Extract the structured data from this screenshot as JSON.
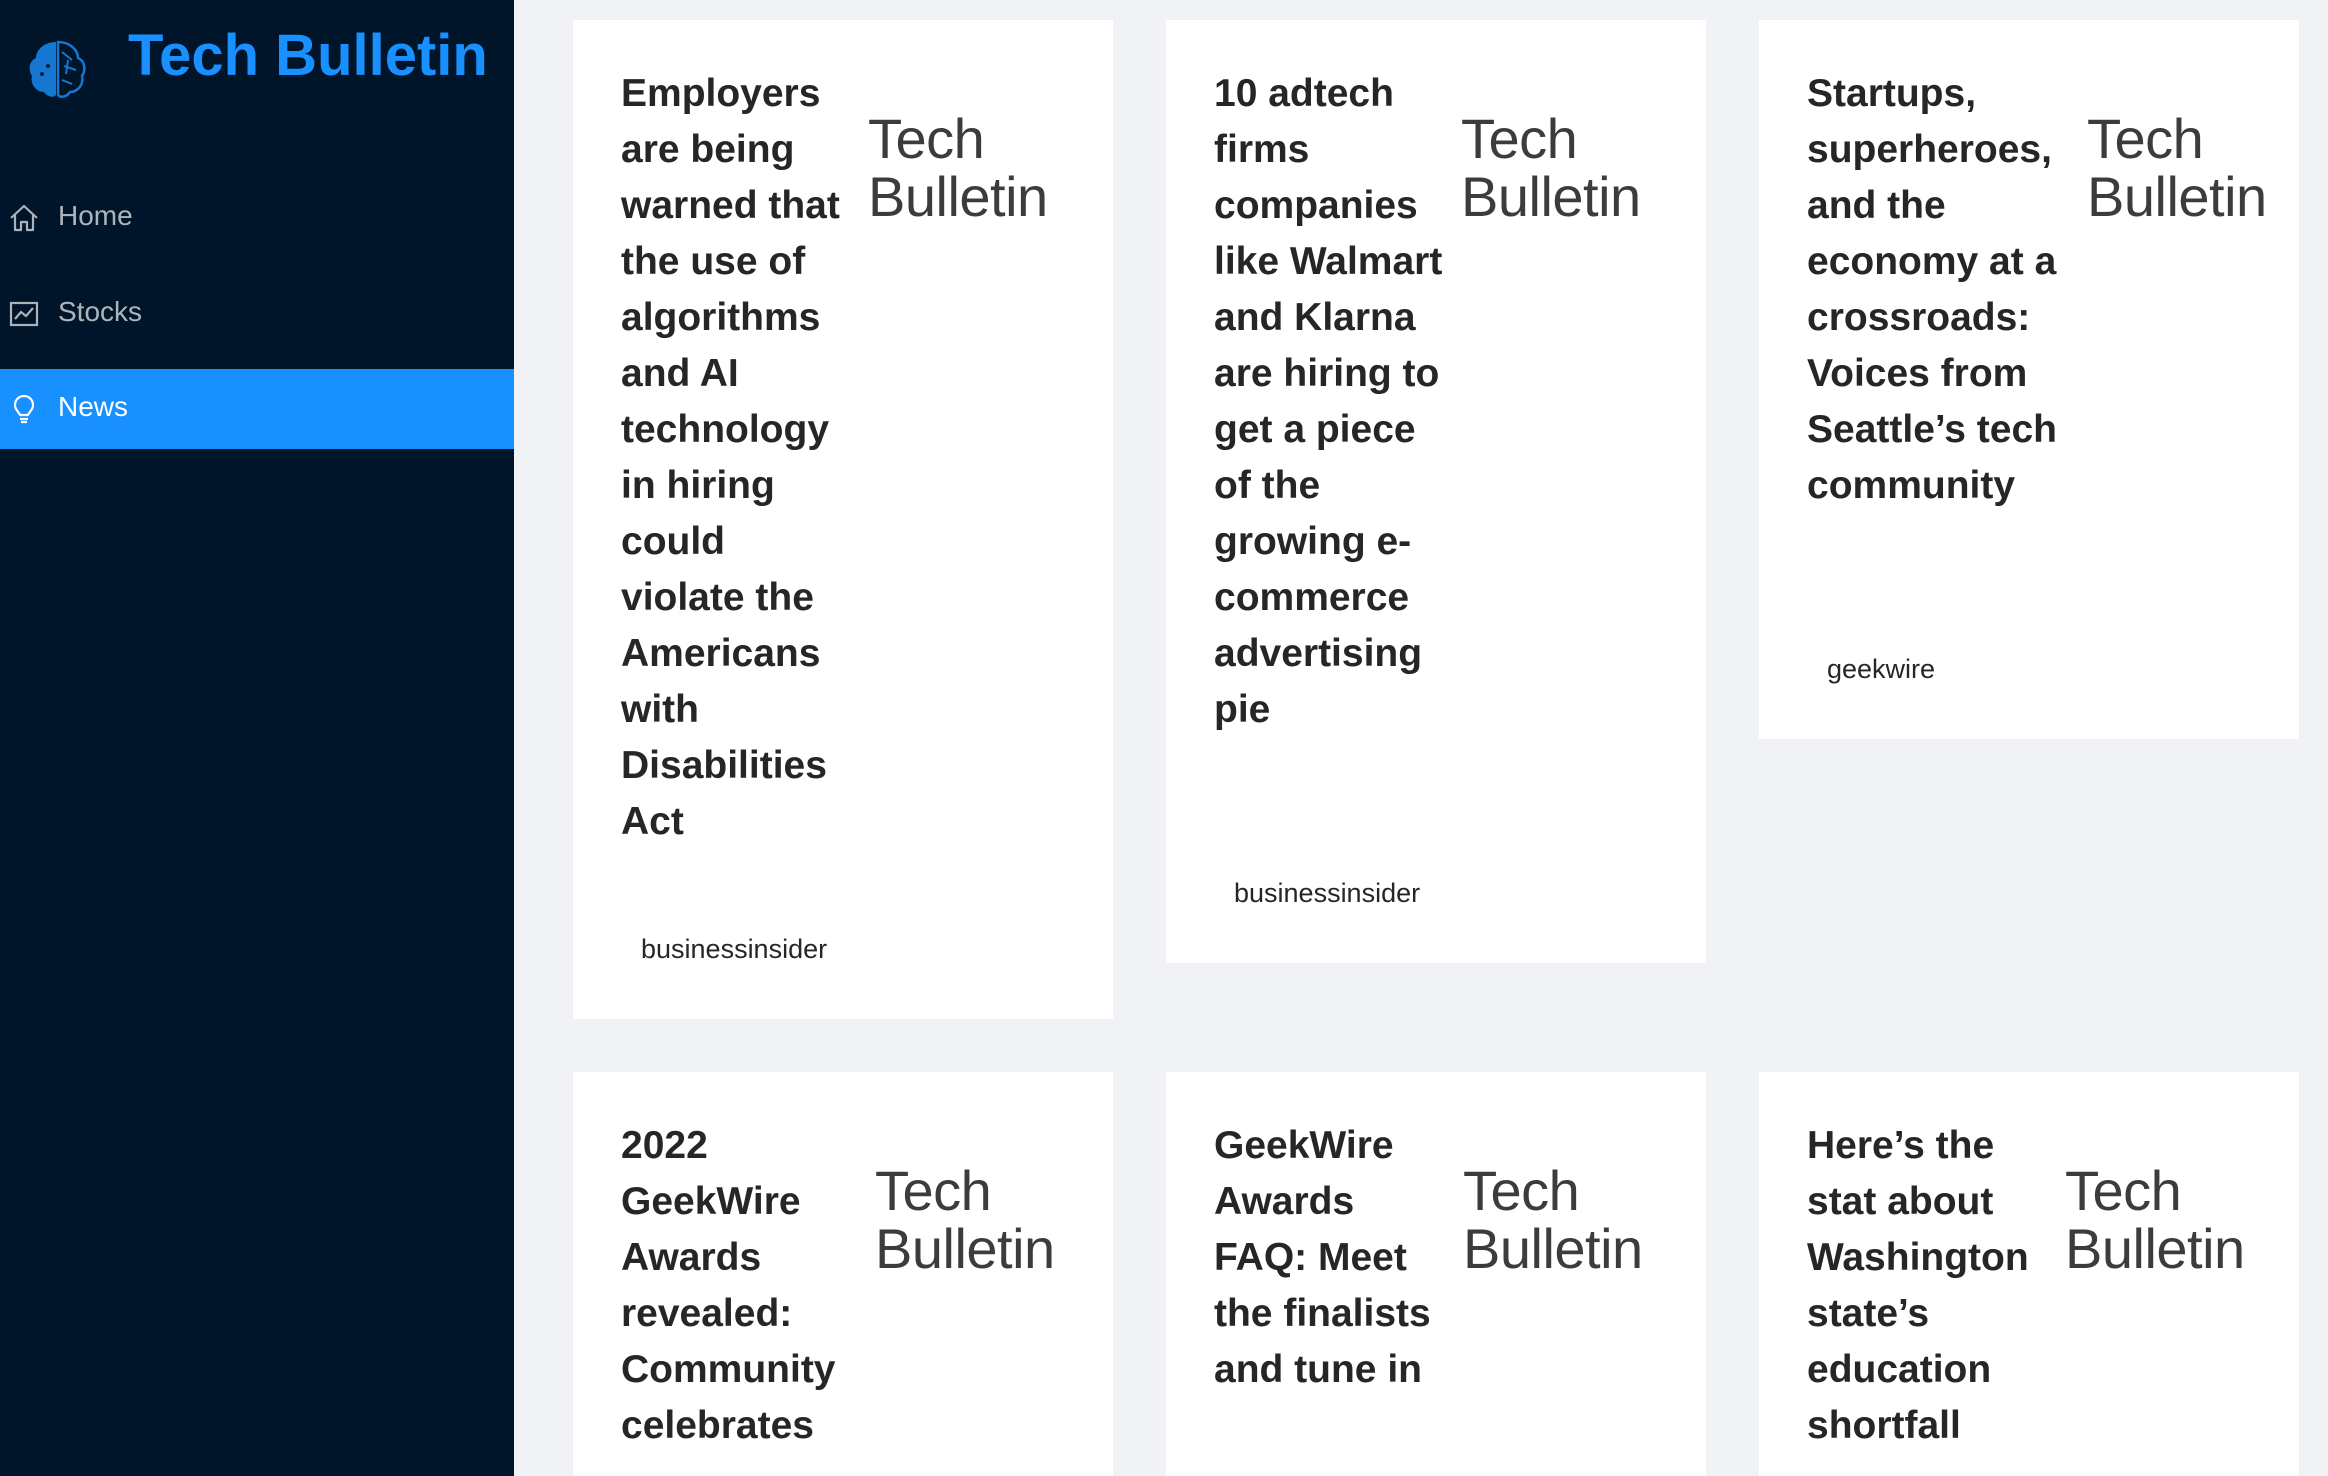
{
  "app": {
    "title": "Tech Bulletin"
  },
  "sidebar": {
    "items": [
      {
        "label": "Home",
        "icon": "home-icon"
      },
      {
        "label": "Stocks",
        "icon": "stock-chart-icon"
      },
      {
        "label": "News",
        "icon": "bulb-icon",
        "selected": true
      }
    ]
  },
  "colors": {
    "sidebar_bg": "#001529",
    "accent": "#1890ff",
    "page_bg": "#f0f2f5"
  },
  "news": [
    {
      "title": "Employers are being warned that the use of algorithms and AI technology in hiring could violate the Americans with Disabilities Act",
      "source": "businessinsider",
      "thumb_line1": "Tech",
      "thumb_line2": "Bulletin"
    },
    {
      "title": "10 adtech firms companies like Walmart and Klarna are hiring to get a piece of the growing e-commerce advertising pie",
      "source": "businessinsider",
      "thumb_line1": "Tech",
      "thumb_line2": "Bulletin"
    },
    {
      "title": "Startups, superheroes, and the economy at a crossroads: Voices from Seattle’s tech community",
      "source": "geekwire",
      "thumb_line1": "Tech",
      "thumb_line2": "Bulletin"
    },
    {
      "title": "2022 GeekWire Awards revealed: Community celebrates",
      "thumb_line1": "Tech",
      "thumb_line2": "Bulletin"
    },
    {
      "title": "GeekWire Awards FAQ: Meet the finalists and tune in",
      "thumb_line1": "Tech",
      "thumb_line2": "Bulletin"
    },
    {
      "title": "Here’s the stat about Washington state’s education shortfall",
      "thumb_line1": "Tech",
      "thumb_line2": "Bulletin"
    }
  ]
}
